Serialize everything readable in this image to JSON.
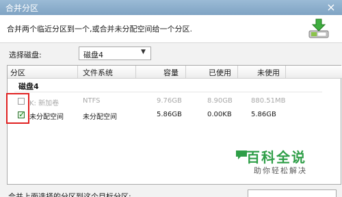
{
  "window": {
    "title": "合并分区",
    "close_glyph": "×"
  },
  "header": {
    "description": "合并两个临近分区到一个,或合并未分配空间给一个分区.",
    "icon": "merge-partition-icon"
  },
  "disk_selector": {
    "label": "选择磁盘:",
    "value": "磁盘4"
  },
  "table": {
    "columns": [
      "分区",
      "文件系统",
      "容量",
      "已使用",
      "未使用"
    ],
    "group_title": "磁盘4",
    "rows": [
      {
        "checked": false,
        "enabled": false,
        "partition": "K: 新加卷",
        "filesystem": "NTFS",
        "capacity": "9.76GB",
        "used": "8.90GB",
        "unused": "880.51MB"
      },
      {
        "checked": true,
        "enabled": true,
        "partition": "未分配空间",
        "filesystem": "未分配空间",
        "capacity": "5.86GB",
        "used": "0.00KB",
        "unused": "5.86GB"
      }
    ]
  },
  "footer": {
    "text": "合并上面选择的分区到这个目标分区:"
  },
  "watermark": {
    "title": "百科全说",
    "subtitle": "助你轻松解决"
  },
  "colors": {
    "highlight": "#e02020",
    "check": "#1d8a1d",
    "watermark_green": "#2e9e47"
  }
}
